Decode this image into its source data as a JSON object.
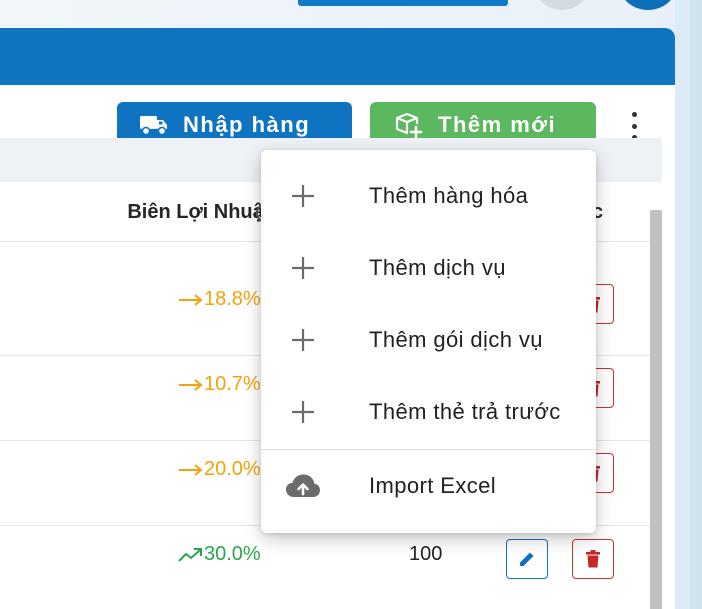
{
  "toolbar": {
    "import_label": "Nhập hàng",
    "add_new_label": "Thêm mới"
  },
  "table": {
    "columns": {
      "margin": "Biên Lợi Nhuận",
      "actions": "c"
    },
    "rows": [
      {
        "margin": "18.8%",
        "trend": "flat",
        "qty": ""
      },
      {
        "margin": "10.7%",
        "trend": "flat",
        "qty": ""
      },
      {
        "margin": "20.0%",
        "trend": "flat",
        "qty": ""
      },
      {
        "margin": "30.0%",
        "trend": "up",
        "qty": "100"
      }
    ]
  },
  "menu": {
    "items": [
      {
        "icon": "plus-icon",
        "label": "Thêm hàng hóa"
      },
      {
        "icon": "plus-icon",
        "label": "Thêm dịch vụ"
      },
      {
        "icon": "plus-icon",
        "label": "Thêm gói dịch vụ"
      },
      {
        "icon": "plus-icon",
        "label": "Thêm thẻ trả trước"
      },
      {
        "icon": "cloud-upload-icon",
        "label": "Import Excel"
      }
    ]
  },
  "colors": {
    "primary": "#0e74c2",
    "success": "#5cb85f",
    "warning": "#f5a20a",
    "trend_up": "#2aa64a",
    "danger": "#d32f2f"
  }
}
